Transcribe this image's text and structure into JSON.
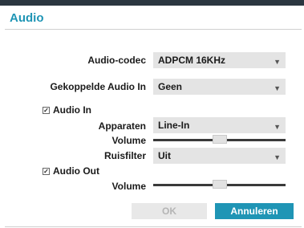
{
  "dialog": {
    "title": "Audio"
  },
  "fields": {
    "codec": {
      "label": "Audio-codec",
      "value": "ADPCM 16KHz"
    },
    "linked": {
      "label": "Gekoppelde Audio In",
      "value": "Geen"
    },
    "audio_in": {
      "label": "Audio In",
      "checked": true
    },
    "device": {
      "label": "Apparaten",
      "value": "Line-In"
    },
    "volume_in": {
      "label": "Volume",
      "level_percent": 50
    },
    "noise": {
      "label": "Ruisfilter",
      "value": "Uit"
    },
    "audio_out": {
      "label": "Audio Out",
      "checked": true
    },
    "volume_out": {
      "label": "Volume",
      "level_percent": 50
    }
  },
  "buttons": {
    "ok": "OK",
    "cancel": "Annuleren"
  },
  "glyphs": {
    "check": "✓",
    "dropdown": "▼"
  },
  "colors": {
    "accent": "#1f95b5",
    "header": "#2b3640"
  }
}
